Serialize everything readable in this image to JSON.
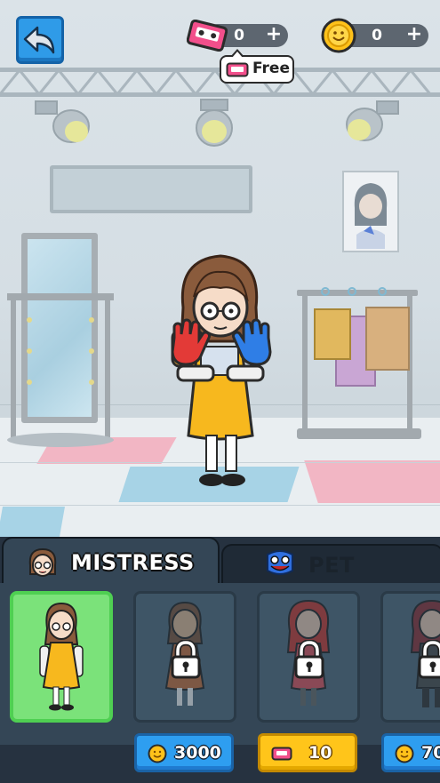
{
  "hud": {
    "back_icon": "back-arrow-icon",
    "tapes": {
      "icon": "cassette-tape-icon",
      "value": "0",
      "plus": "+"
    },
    "coins": {
      "icon": "smiley-coin-icon",
      "value": "0",
      "plus": "+"
    },
    "free_offer": {
      "icon": "cassette-tape-icon",
      "label": "Free"
    }
  },
  "tabs": [
    {
      "label": "MISTRESS",
      "icon": "mistress-face-icon",
      "active": true
    },
    {
      "label": "PET",
      "icon": "huggy-face-icon",
      "active": false
    }
  ],
  "cards": [
    {
      "state": "selected",
      "outfit": "yellow-dress"
    },
    {
      "state": "locked",
      "outfit": "brown-dress",
      "price": {
        "currency": "coin",
        "icon": "smiley-coin-icon",
        "value": "3000"
      }
    },
    {
      "state": "locked",
      "outfit": "red-hair",
      "price": {
        "currency": "tape",
        "icon": "cassette-tape-icon",
        "value": "10"
      }
    },
    {
      "state": "locked",
      "outfit": "dark-outfit",
      "price": {
        "currency": "coin",
        "icon": "smiley-coin-icon",
        "value": "70"
      }
    }
  ],
  "colors": {
    "coin_button": "#2e9ef0",
    "tape_button": "#ffc51a",
    "selected_card": "#7be27a",
    "panel": "#344656"
  }
}
